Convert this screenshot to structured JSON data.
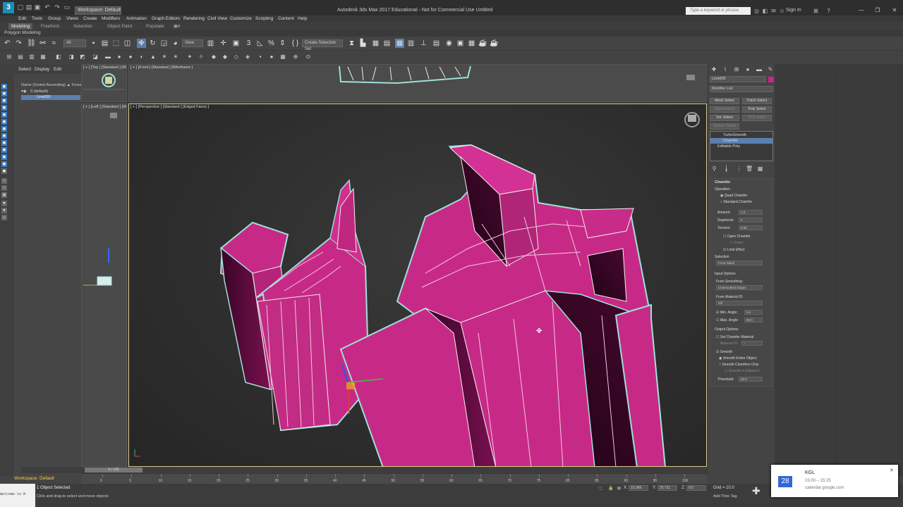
{
  "titlebar": {
    "logo": "3",
    "workspace": "Workspace: Default",
    "title": "Autodesk 3ds Max 2017 Educational - Not for Commercial Use    Untitled",
    "search_placeholder": "Type a keyword or phrase",
    "sign_in": "Sign In"
  },
  "menu": [
    "Edit",
    "Tools",
    "Group",
    "Views",
    "Create",
    "Modifiers",
    "Animation",
    "Graph Editors",
    "Rendering",
    "Civil View",
    "Customize",
    "Scripting",
    "Content",
    "Help"
  ],
  "ribbon": {
    "tabs": [
      "Modeling",
      "Freeform",
      "Selection",
      "Object Paint",
      "Populate"
    ],
    "sub_label": "Polygon Modeling"
  },
  "toolbar": {
    "filter": "All",
    "ref_coord": "View",
    "selection_set": "Create Selection Set"
  },
  "explorer": {
    "tabs": [
      "Select",
      "Display",
      "Edit"
    ],
    "header": "Name (Sorted Ascending)  ▲ Frozen",
    "row1": "0 (default)",
    "row2": "Line002",
    "workspace_label": "Workspace: Default"
  },
  "viewports": {
    "top": "[ + ] [Top ] [Standard ] [W",
    "front": "[ + ] [Front ] [Standard ] [Wireframe ]",
    "left": "[ + ] [Left ] [Standard ] [W",
    "perspective": "[ + ] [Perspective ] [Standard ] [Edged Faces ]"
  },
  "command_panel": {
    "object_name": "Line002",
    "object_color": "#d21f8f",
    "modifier_list": "Modifier List",
    "buttons": [
      "Mesh Select",
      "Patch Select",
      "SplineSelect",
      "Poly Select",
      "Vol. Select",
      "FFD Select",
      "Surface Select"
    ],
    "stack": [
      "TurboSmooth",
      "Chamfer",
      "Editable Poly"
    ],
    "rollout": {
      "title": "Chamfer",
      "operation_label": "Operation",
      "quad_chamfer": "Quad Chamfer",
      "standard_chamfer": "Standard Chamfer",
      "amount_label": "Amount:",
      "amount": "1.0",
      "segments_label": "Segments:",
      "segments": "5",
      "tension_label": "Tension:",
      "tension": "0.69",
      "open_chamfer": "Open Chamfer",
      "invert": "Invert",
      "limit_effect": "Limit Effect",
      "selection_label": "Selection",
      "selection_value": "From Stack",
      "input_options": "Input Options",
      "from_smoothing": "From Smoothing:",
      "smoothing_value": "Unsmoothed Edges",
      "from_material": "From Material ID:",
      "material_value": "Off",
      "min_angle_label": "Min. Angle:",
      "min_angle": "5.0",
      "max_angle_label": "Max. Angle:",
      "max_angle": "90.0",
      "output_options": "Output Options",
      "set_chamfer_material": "Set Chamfer Material",
      "material_id_label": "Material ID:",
      "material_id": "1",
      "smooth": "Smooth",
      "smooth_entire": "Smooth Entire Object",
      "smooth_chamfers": "Smooth Chamfers Only",
      "smooth_to_adjacent": "Smooth to Adjacent",
      "threshold_label": "Threshold:",
      "threshold": "30.0"
    }
  },
  "timeline": {
    "slider": "0 / 100",
    "ticks": [
      "0",
      "5",
      "10",
      "15",
      "20",
      "25",
      "30",
      "35",
      "40",
      "45",
      "50",
      "55",
      "60",
      "65",
      "70",
      "75",
      "80",
      "85",
      "90",
      "95",
      "100"
    ]
  },
  "status": {
    "maxscript": "Welcome to M",
    "selected": "1 Object Selected",
    "prompt": "Click and drag to select and move objects",
    "x": "15.366",
    "y": "25.711",
    "z": "0.0",
    "grid": "Grid = 10.0",
    "add_time_tag": "Add Time Tag"
  },
  "toast": {
    "day": "28",
    "title": "KGL",
    "time": "15:00 – 15:25",
    "source": "calendar.google.com"
  }
}
